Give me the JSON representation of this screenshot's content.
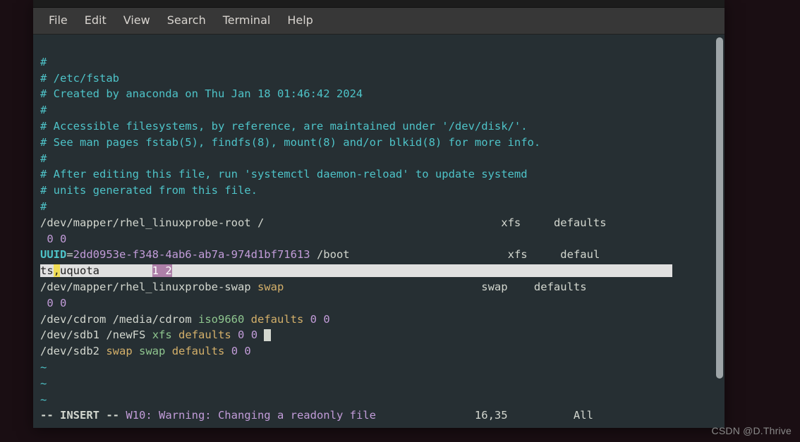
{
  "menubar": {
    "items": [
      "File",
      "Edit",
      "View",
      "Search",
      "Terminal",
      "Help"
    ]
  },
  "terminal": {
    "comments": [
      "#",
      "# /etc/fstab",
      "# Created by anaconda on Thu Jan 18 01:46:42 2024",
      "#",
      "# Accessible filesystems, by reference, are maintained under '/dev/disk/'.",
      "# See man pages fstab(5), findfs(8), mount(8) and/or blkid(8) for more info.",
      "#",
      "# After editing this file, run 'systemctl daemon-reload' to update systemd",
      "# units generated from this file.",
      "#"
    ],
    "root_line": {
      "dev": "/dev/mapper/rhel_linuxprobe-root",
      "mount": "/",
      "fs": "xfs",
      "opts": "defaults",
      "dump_pass": " 0 0"
    },
    "uuid_line": {
      "label": "UUID",
      "eq": "=",
      "id": "2dd0953e-f348-4ab6-ab7a-974d1bf71613",
      "mount": "/boot",
      "fs": "xfs",
      "opts_head": "defaul",
      "opts_wrap": "ts",
      "comma": ",",
      "opts_tail": "uquota        ",
      "dump_pass": "1 2"
    },
    "swap_line": {
      "dev": "/dev/mapper/rhel_linuxprobe-swap",
      "mount": "swap",
      "fs": "swap",
      "opts": "defaults",
      "dump_pass": " 0 0"
    },
    "cdrom_line": {
      "dev": "/dev/cdrom",
      "mount": "/media/cdrom",
      "fs": "iso9660",
      "opts": "defaults",
      "dump_pass": "0 0"
    },
    "sdb1_line": {
      "dev": "/dev/sdb1",
      "mount": "/newFS",
      "fs": "xfs",
      "opts": "defaults",
      "dump_pass": "0 0"
    },
    "sdb2_line": {
      "dev": "/dev/sdb2",
      "mount": "swap",
      "fs": "swap",
      "opts": "defaults",
      "dump_pass": "0 0"
    },
    "tildes": [
      "~",
      "~",
      "~"
    ],
    "status": {
      "mode": "-- INSERT --",
      "warning": "W10: Warning: Changing a readonly file",
      "pos": "16,35",
      "scroll": "All"
    }
  },
  "watermark": "CSDN @D.Thrive"
}
